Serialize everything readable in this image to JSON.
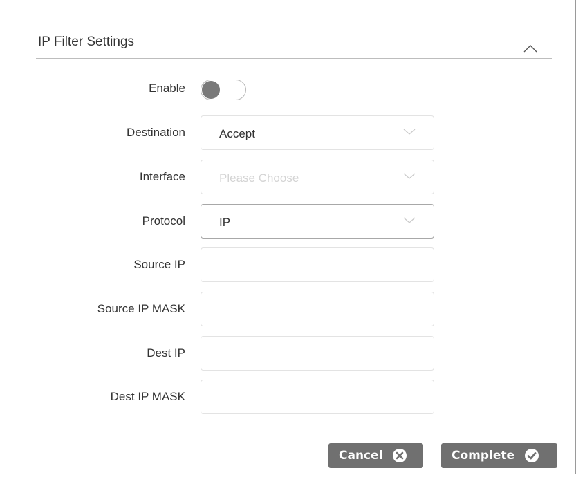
{
  "panel": {
    "title": "IP Filter Settings"
  },
  "form": {
    "enable": {
      "label": "Enable",
      "on": false
    },
    "destination": {
      "label": "Destination",
      "value": "Accept"
    },
    "interface": {
      "label": "Interface",
      "placeholder": "Please Choose"
    },
    "protocol": {
      "label": "Protocol",
      "value": "IP"
    },
    "source_ip": {
      "label": "Source IP",
      "value": ""
    },
    "source_ip_mask": {
      "label": "Source IP MASK",
      "value": ""
    },
    "dest_ip": {
      "label": "Dest IP",
      "value": ""
    },
    "dest_ip_mask": {
      "label": "Dest IP MASK",
      "value": ""
    }
  },
  "buttons": {
    "cancel": "Cancel",
    "complete": "Complete"
  },
  "icons": {
    "collapse": "chevron-up-icon",
    "dropdown": "chevron-down-icon",
    "cancel": "close-circle-icon",
    "complete": "check-circle-icon"
  },
  "colors": {
    "button_bg": "#707070",
    "toggle_knob": "#7a7a7a",
    "text": "#333333"
  }
}
